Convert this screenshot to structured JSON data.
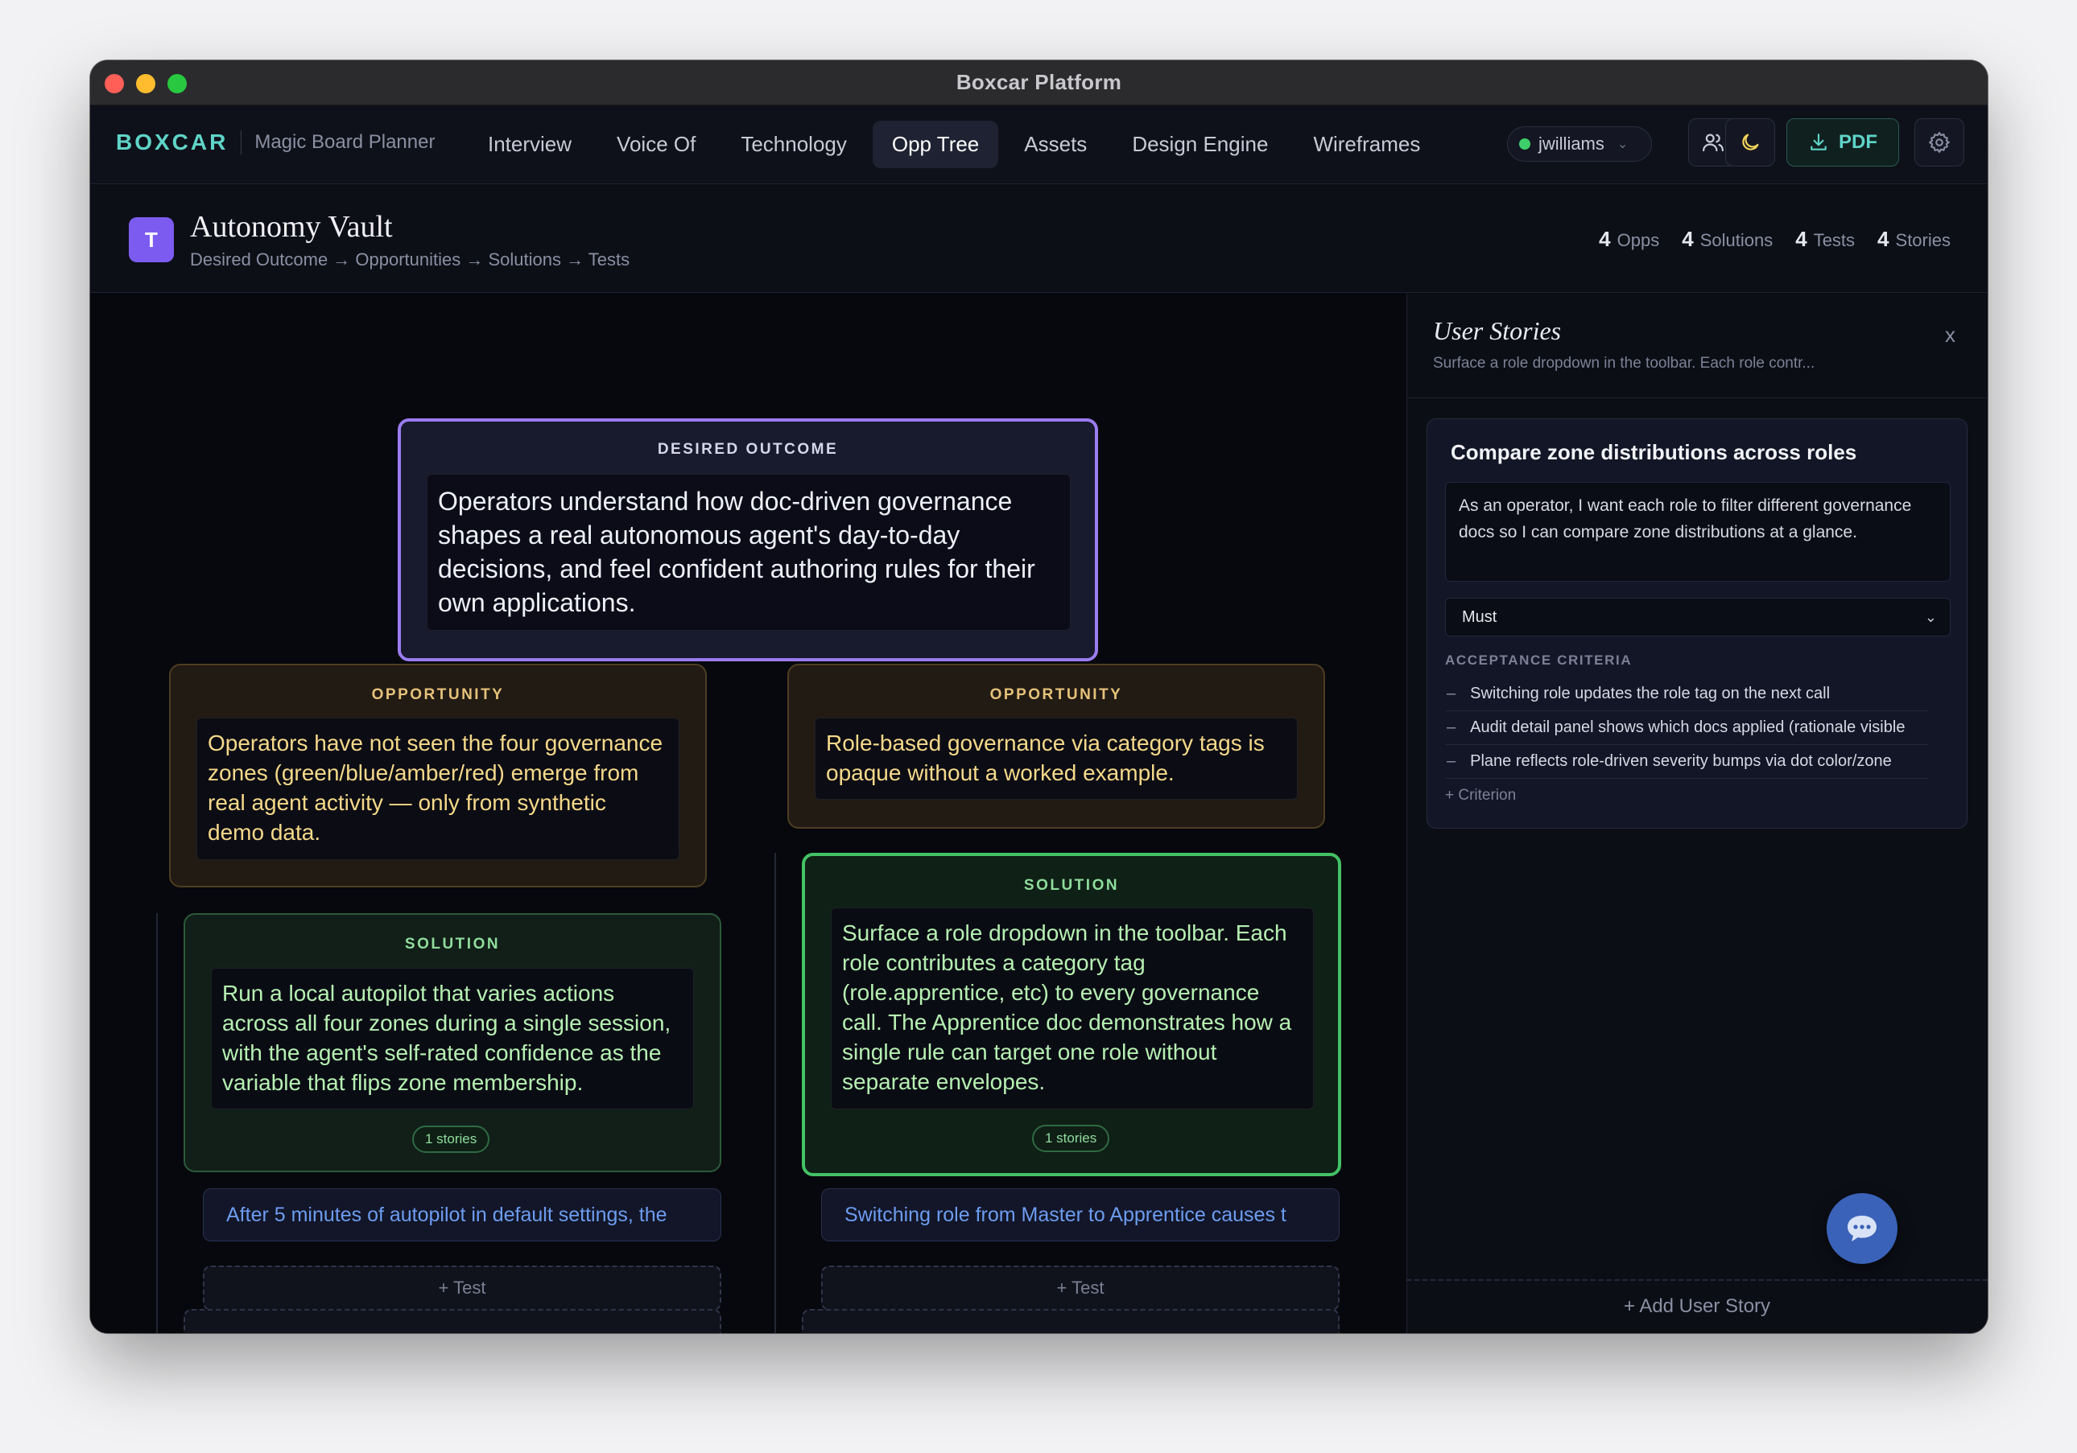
{
  "window": {
    "title": "Boxcar Platform"
  },
  "nav": {
    "brand": "BOXCAR",
    "subtitle": "Magic Board Planner",
    "tabs": [
      {
        "label": "Interview"
      },
      {
        "label": "Voice Of"
      },
      {
        "label": "Technology"
      },
      {
        "label": "Opp Tree",
        "active": true
      },
      {
        "label": "Assets"
      },
      {
        "label": "Design Engine"
      },
      {
        "label": "Wireframes"
      }
    ],
    "user": "jwilliams",
    "pdf_label": "PDF"
  },
  "project": {
    "avatar_letter": "T",
    "name": "Autonomy Vault",
    "breadcrumb": "Desired Outcome → Opportunities → Solutions → Tests",
    "stats": [
      {
        "count": "4",
        "label": "Opps"
      },
      {
        "count": "4",
        "label": "Solutions"
      },
      {
        "count": "4",
        "label": "Tests"
      },
      {
        "count": "4",
        "label": "Stories"
      }
    ]
  },
  "tree": {
    "outcome": {
      "label": "DESIRED OUTCOME",
      "text": "Operators understand how doc-driven governance shapes a real autonomous agent's day-to-day decisions, and feel confident authoring rules for their own applications."
    },
    "opportunities": [
      {
        "label": "OPPORTUNITY",
        "text": "Operators have not seen the four governance zones (green/blue/amber/red) emerge from real agent activity — only from synthetic demo data."
      },
      {
        "label": "OPPORTUNITY",
        "text": "Role-based governance via category tags is opaque without a worked example."
      }
    ],
    "solutions": [
      {
        "label": "SOLUTION",
        "text": "Run a local autopilot that varies actions across all four zones during a single session, with the agent's self-rated confidence as the variable that flips zone membership.",
        "badge": "1 stories",
        "test": "After 5 minutes of autopilot in default settings, the",
        "add_test": "+ Test"
      },
      {
        "label": "SOLUTION",
        "text": "Surface a role dropdown in the toolbar. Each role contributes a category tag (role.apprentice, etc) to every governance call. The Apprentice doc demonstrates how a single rule can target one role without separate envelopes.",
        "badge": "1 stories",
        "test": "Switching role from Master to Apprentice causes t",
        "add_test": "+ Test"
      }
    ]
  },
  "panel": {
    "title": "User Stories",
    "subtitle": "Surface a role dropdown in the toolbar. Each role contr...",
    "close": "x",
    "story": {
      "title": "Compare zone distributions across roles",
      "body": "As an operator, I want each role to filter different governance docs so I can compare zone distributions at a glance.",
      "priority": "Must",
      "criteria_label": "ACCEPTANCE CRITERIA",
      "criteria": [
        "Switching role updates the role tag on the next call",
        "Audit detail panel shows which docs applied (rationale visible",
        "Plane reflects role-driven severity bumps via dot color/zone"
      ],
      "add_criterion": "+ Criterion"
    },
    "add_story": "+ Add User Story"
  },
  "colors": {
    "brand": "#5fd4c8",
    "outcome_border": "#9b7cf0",
    "opportunity": "#e6c27a",
    "solution": "#43c266",
    "test_text": "#6d9cf0"
  }
}
